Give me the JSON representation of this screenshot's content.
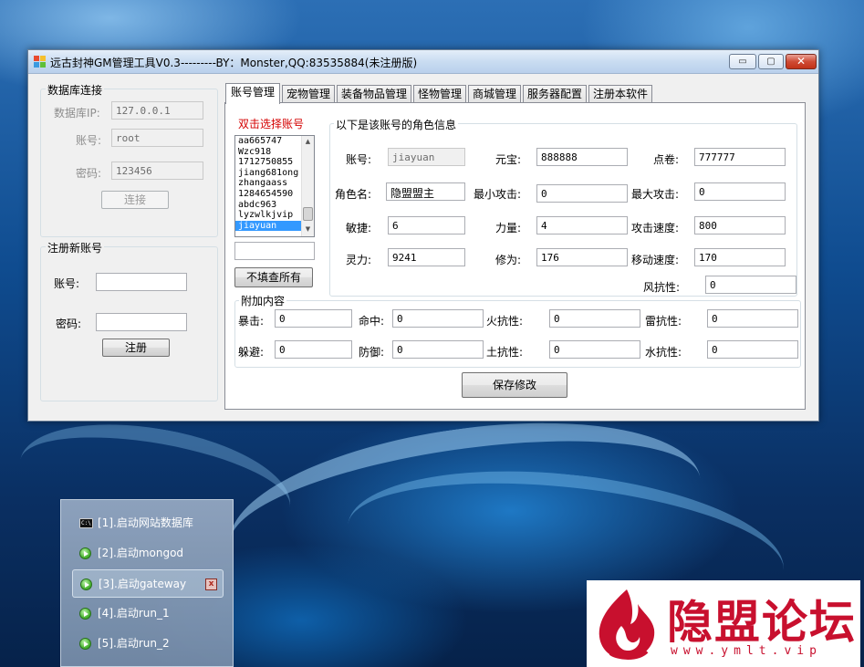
{
  "window": {
    "title": "远古封神GM管理工具V0.3---------BY：Monster,QQ:83535884(未注册版)",
    "min_glyph": "▭",
    "max_glyph": "▢",
    "close_glyph": "✕"
  },
  "db": {
    "group_title": "数据库连接",
    "ip_label": "数据库IP:",
    "ip_value": "127.0.0.1",
    "account_label": "账号:",
    "account_value": "root",
    "password_label": "密码:",
    "password_value": "123456",
    "connect_label": "连接"
  },
  "register": {
    "group_title": "注册新账号",
    "account_label": "账号:",
    "account_value": "",
    "password_label": "密码:",
    "password_value": "",
    "register_label": "注册"
  },
  "tabs": [
    {
      "label": "账号管理"
    },
    {
      "label": "宠物管理"
    },
    {
      "label": "装备物品管理"
    },
    {
      "label": "怪物管理"
    },
    {
      "label": "商城管理"
    },
    {
      "label": "服务器配置"
    },
    {
      "label": "注册本软件"
    }
  ],
  "account_tab": {
    "select_label": "双击选择账号",
    "accounts": [
      "aa665747",
      "Wzc918",
      "1712750855",
      "jiang681ong",
      "zhangaass",
      "1284654590",
      "abdc963",
      "lyzwlkjvip",
      "jiayuan"
    ],
    "selected_account": "jiayuan",
    "filter_value": "",
    "fill_all_label": "不填查所有",
    "role_group_title": "以下是该账号的角色信息",
    "fields": {
      "account_label": "账号:",
      "account_value": "jiayuan",
      "yuanbao_label": "元宝:",
      "yuanbao_value": "888888",
      "dianjuan_label": "点卷:",
      "dianjuan_value": "777777",
      "role_name_label": "角色名:",
      "role_name_value": "隐盟盟主",
      "min_attack_label": "最小攻击:",
      "min_attack_value": "0",
      "max_attack_label": "最大攻击:",
      "max_attack_value": "0",
      "agility_label": "敏捷:",
      "agility_value": "6",
      "strength_label": "力量:",
      "strength_value": "4",
      "attack_speed_label": "攻击速度:",
      "attack_speed_value": "800",
      "spirit_label": "灵力:",
      "spirit_value": "9241",
      "cultivation_label": "修为:",
      "cultivation_value": "176",
      "move_speed_label": "移动速度:",
      "move_speed_value": "170",
      "wind_res_label": "风抗性:",
      "wind_res_value": "0"
    },
    "extra_group_title": "附加内容",
    "extra": {
      "crit_label": "暴击:",
      "crit_value": "0",
      "hit_label": "命中:",
      "hit_value": "0",
      "fire_res_label": "火抗性:",
      "fire_res_value": "0",
      "thunder_res_label": "雷抗性:",
      "thunder_res_value": "0",
      "dodge_label": "躲避:",
      "dodge_value": "0",
      "defense_label": "防御:",
      "defense_value": "0",
      "earth_res_label": "土抗性:",
      "earth_res_value": "0",
      "water_res_label": "水抗性:",
      "water_res_value": "0"
    },
    "save_label": "保存修改"
  },
  "launcher": {
    "items": [
      {
        "label": "[1].启动网站数据库",
        "icon": "cmd-icon"
      },
      {
        "label": "[2].启动mongod",
        "icon": "play-icon"
      },
      {
        "label": "[3].启动gateway",
        "icon": "play-icon"
      },
      {
        "label": "[4].启动run_1",
        "icon": "play-icon"
      },
      {
        "label": "[5].启动run_2",
        "icon": "play-icon"
      }
    ],
    "cmd_glyph": "C:\\",
    "close_glyph": "x"
  },
  "watermark": {
    "text": "隐盟论坛",
    "url": "www.ymlt.vip"
  },
  "colors": {
    "selection": "#3399ff",
    "accent_red": "#c8102e",
    "select_label_red": "#d40000"
  }
}
